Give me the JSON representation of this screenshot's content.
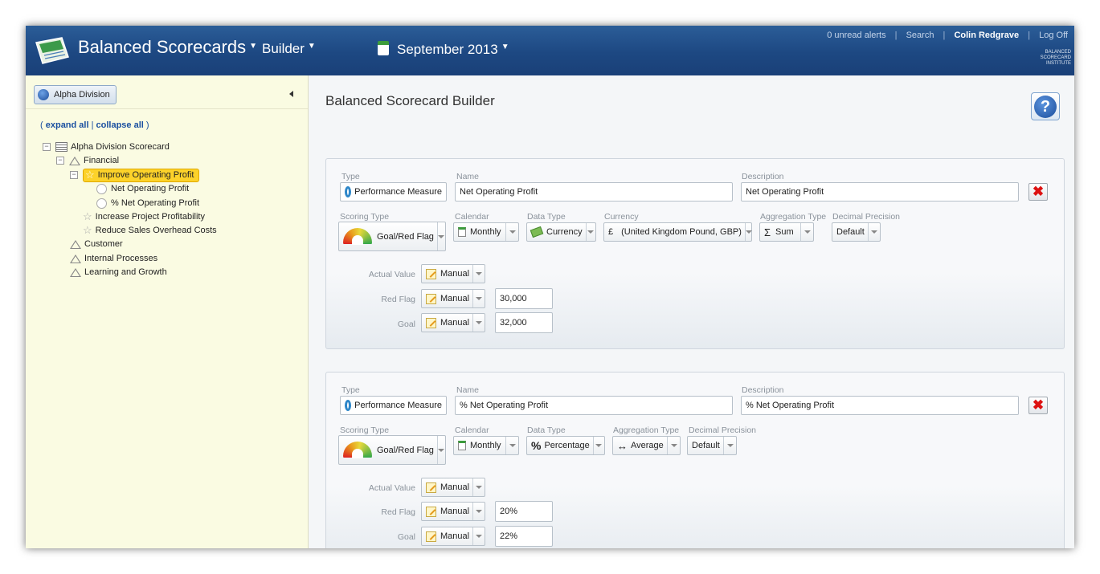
{
  "header": {
    "app_title": "Balanced Scorecards",
    "builder_label": "Builder",
    "month_label": "September 2013",
    "alerts": "0 unread alerts",
    "search": "Search",
    "user": "Colin Redgrave",
    "logoff": "Log Off",
    "separator": "|",
    "logo_lines": [
      "BALANCED",
      "SCORECARD",
      "INSTITUTE"
    ]
  },
  "sidebar": {
    "division_button": "Alpha Division",
    "expand_all": "expand all",
    "collapse_all": "collapse all",
    "link_sep": "|",
    "paren_open": "(",
    "paren_close": ")",
    "tree": {
      "root": "Alpha Division Scorecard",
      "financial": "Financial",
      "improve_operating_profit": "Improve Operating Profit",
      "net_operating_profit": "Net Operating Profit",
      "pct_net_operating_profit": "% Net Operating Profit",
      "increase_project_profitability": "Increase Project Profitability",
      "reduce_sales_overhead": "Reduce Sales Overhead Costs",
      "customer": "Customer",
      "internal_processes": "Internal Processes",
      "learning_growth": "Learning and Growth"
    }
  },
  "main": {
    "title": "Balanced Scorecard Builder",
    "help_symbol": "?",
    "delete_symbol": "✖",
    "labels": {
      "type": "Type",
      "name": "Name",
      "description": "Description",
      "scoring_type": "Scoring Type",
      "calendar": "Calendar",
      "data_type": "Data Type",
      "currency": "Currency",
      "aggregation_type": "Aggregation Type",
      "decimal_precision": "Decimal Precision",
      "actual_value": "Actual Value",
      "red_flag": "Red Flag",
      "goal": "Goal"
    },
    "measures": [
      {
        "type": "Performance Measure",
        "name": "Net Operating Profit",
        "description": "Net Operating Profit",
        "scoring_type": "Goal/Red Flag",
        "calendar": "Monthly",
        "data_type": "Currency",
        "currency_symbol": "£",
        "currency": "(United Kingdom Pound, GBP)",
        "aggregation_symbol": "Σ",
        "aggregation": "Sum",
        "decimal_precision": "Default",
        "actual_value_source": "Manual",
        "red_flag_source": "Manual",
        "red_flag_value": "30,000",
        "goal_source": "Manual",
        "goal_value": "32,000"
      },
      {
        "type": "Performance Measure",
        "name": "% Net Operating Profit",
        "description": "% Net Operating Profit",
        "scoring_type": "Goal/Red Flag",
        "calendar": "Monthly",
        "data_type_symbol": "%",
        "data_type": "Percentage",
        "aggregation_symbol": "↔",
        "aggregation": "Average",
        "decimal_precision": "Default",
        "actual_value_source": "Manual",
        "red_flag_source": "Manual",
        "red_flag_value": "20%",
        "goal_source": "Manual",
        "goal_value": "22%"
      }
    ]
  },
  "colors": {
    "header_bg": "#1d4882",
    "sidebar_bg": "#fafbe2",
    "selected_node": "#fcd22a",
    "link": "#1a4fa0"
  }
}
